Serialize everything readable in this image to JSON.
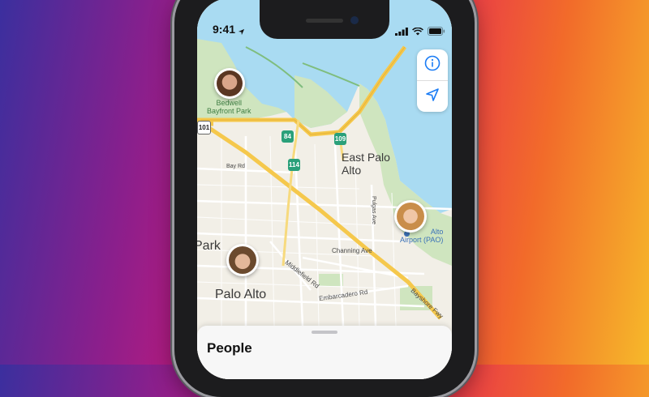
{
  "status_bar": {
    "time": "9:41"
  },
  "map": {
    "labels": {
      "bedwell": "Bedwell\nBayfront Park",
      "east_palo_alto": "East Palo\nAlto",
      "palo_alto": "Palo Alto",
      "park_fragment": "Park",
      "airport": "Alto\nAirport (PAO)",
      "bay_rd": "Bay Rd",
      "pulgas": "Pulgas Ave",
      "channing": "Channing Ave",
      "middlefield": "Middlefield Rd",
      "embarcadero": "Embarcadero Rd",
      "bayshore": "Bayshore Fwy"
    },
    "route_shields": {
      "r84": "84",
      "r109": "109",
      "r114": "114",
      "r101": "101"
    }
  },
  "controls": {
    "info": "info-icon",
    "location": "location-arrow-icon"
  },
  "people_sheet": {
    "title": "People"
  },
  "colors": {
    "water": "#a9dbf2",
    "land": "#f2efe7",
    "park": "#cfe5bf",
    "freeway": "#f5c84c",
    "road": "#ffffff",
    "shield": "#2aa07a"
  }
}
